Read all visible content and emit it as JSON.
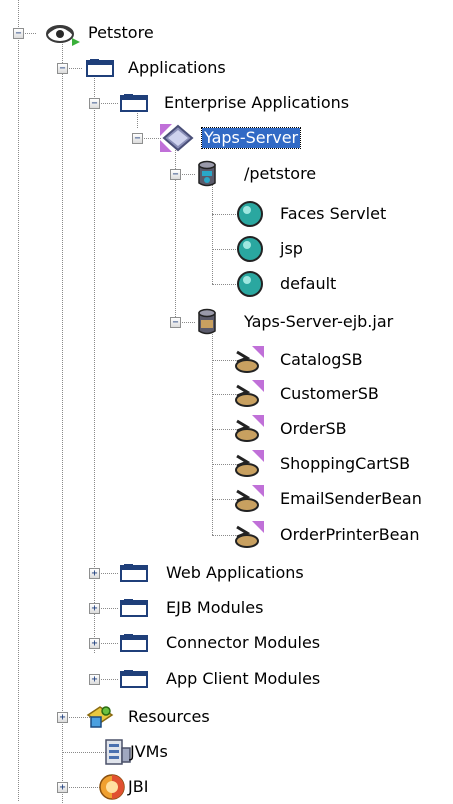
{
  "tree": {
    "root": {
      "label": "Petstore",
      "expanded": true,
      "icon": "eye-server-icon"
    },
    "applications": {
      "label": "Applications",
      "expanded": true,
      "icon": "folder-icon"
    },
    "enterprise_apps": {
      "label": "Enterprise Applications",
      "expanded": true,
      "icon": "folder-icon"
    },
    "yaps_server": {
      "label": "Yaps-Server",
      "expanded": true,
      "selected": true,
      "icon": "ear-module-icon"
    },
    "petstore_web": {
      "label": "/petstore",
      "expanded": true,
      "icon": "web-module-icon"
    },
    "servlets": [
      {
        "label": "Faces Servlet",
        "icon": "servlet-icon"
      },
      {
        "label": "jsp",
        "icon": "servlet-icon"
      },
      {
        "label": "default",
        "icon": "servlet-icon"
      }
    ],
    "ejb_jar": {
      "label": "Yaps-Server-ejb.jar",
      "expanded": true,
      "icon": "ejb-module-icon"
    },
    "beans": [
      {
        "label": "CatalogSB",
        "icon": "session-bean-icon"
      },
      {
        "label": "CustomerSB",
        "icon": "session-bean-icon"
      },
      {
        "label": "OrderSB",
        "icon": "session-bean-icon"
      },
      {
        "label": "ShoppingCartSB",
        "icon": "session-bean-icon"
      },
      {
        "label": "EmailSenderBean",
        "icon": "session-bean-icon"
      },
      {
        "label": "OrderPrinterBean",
        "icon": "session-bean-icon"
      }
    ],
    "collapsed_folders": [
      {
        "label": "Web Applications",
        "icon": "folder-icon"
      },
      {
        "label": "EJB Modules",
        "icon": "folder-icon"
      },
      {
        "label": "Connector Modules",
        "icon": "folder-icon"
      },
      {
        "label": "App Client Modules",
        "icon": "folder-icon"
      }
    ],
    "resources": {
      "label": "Resources",
      "expanded": false,
      "icon": "resources-icon"
    },
    "jvms": {
      "label": "JVMs",
      "icon": "jvm-icon"
    },
    "jbi": {
      "label": "JBI",
      "expanded": false,
      "icon": "jbi-icon"
    }
  },
  "glyphs": {
    "expanded": "−",
    "collapsed": "+"
  },
  "colors": {
    "selection": "#316ac5",
    "folder": "#1f3f7a",
    "servlet": "#2aa7a0",
    "bean": "#c8a060"
  }
}
